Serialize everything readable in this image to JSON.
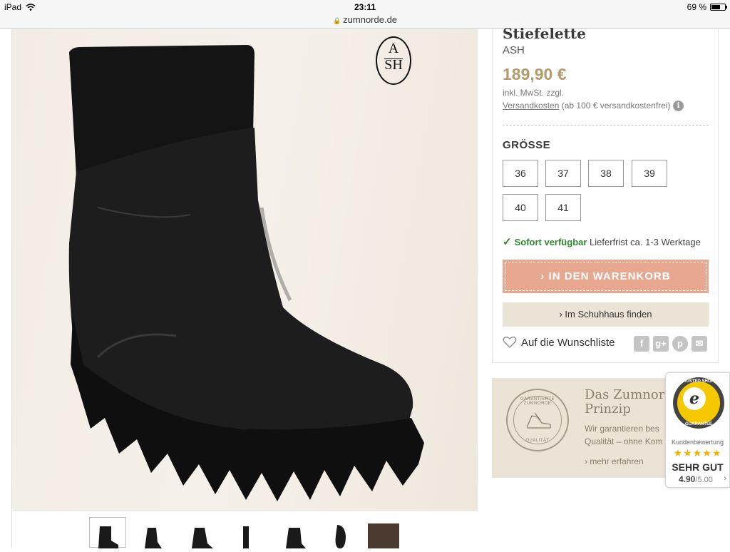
{
  "status_bar": {
    "device": "iPad",
    "time": "23:11",
    "battery_text": "69 %",
    "battery_level": 0.69
  },
  "url_bar": {
    "url": "zumnorde.de"
  },
  "product": {
    "brand_logo": {
      "line1": "A",
      "line2": "SH"
    },
    "title": "Stiefelette",
    "brand": "ASH",
    "price": "189,90 €",
    "tax_note": "inkl. MwSt. zzgl.",
    "shipping_link": "Versandkosten",
    "shipping_note": "(ab 100 € versandkostenfrei)",
    "info_icon": "i",
    "size_label": "GRÖSSE",
    "sizes": [
      "36",
      "37",
      "38",
      "39",
      "40",
      "41"
    ],
    "availability_icon": "✓",
    "availability_status": "Sofort verfügbar",
    "availability_delivery": "Lieferfrist ca. 1-3 Werktage",
    "cart_button": "› IN DEN WARENKORB",
    "store_button": "› Im Schuhhaus finden",
    "wishlist": "Auf die Wunschliste",
    "social_icons": [
      "f",
      "g+",
      "p",
      "✉"
    ],
    "thumbnail_count": 7,
    "active_thumbnail": 1
  },
  "prinzip": {
    "seal_top": "GARANTIERTE ZUMNORDE",
    "seal_bottom": "QUALITÄT",
    "title": "Das Zumnorde Prinzip",
    "text_line1": "Wir garantieren bes",
    "text_line2": "Qualität – ohne Kom",
    "link": "› mehr erfahren"
  },
  "trusted_shops": {
    "seal_top": "TRUSTED SHOPS",
    "seal_letter": "e",
    "seal_bottom": "GUARANTEE",
    "label": "Kundenbewertung",
    "stars": "★★★★★",
    "rating_text": "SEHR GUT",
    "score": "4.90",
    "max": "/5.00",
    "arrow": "›"
  },
  "colors": {
    "price": "#b39a6b",
    "cart_button": "#e8a890",
    "store_button": "#ebe4d6",
    "available": "#2f8a2f",
    "stars": "#f5b400"
  }
}
